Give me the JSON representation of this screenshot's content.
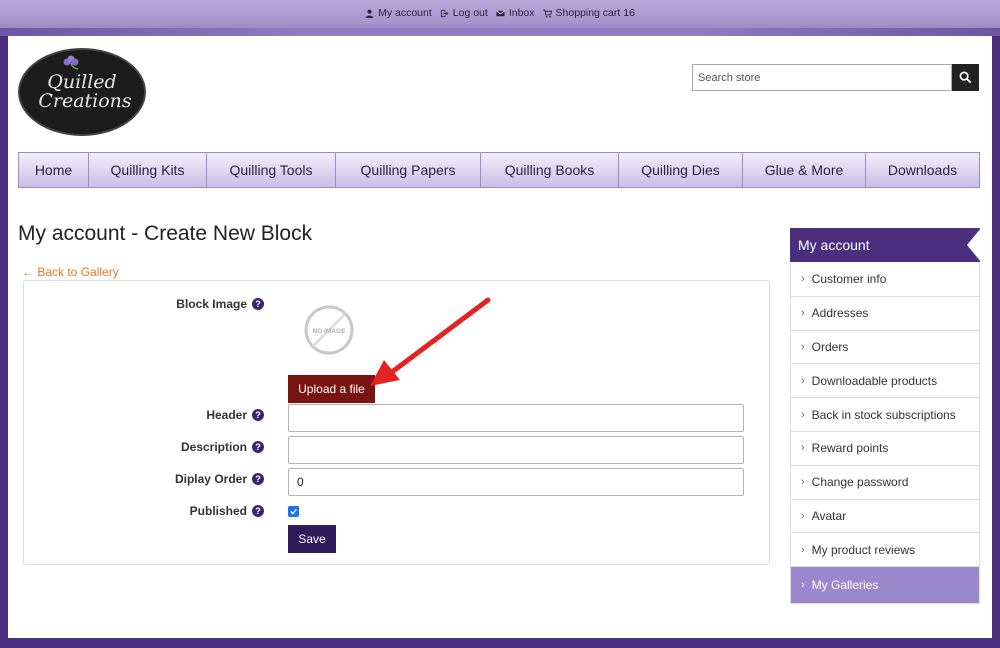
{
  "top_links": {
    "my_account": "My account",
    "log_out": "Log out",
    "inbox": "Inbox",
    "shopping_cart": "Shopping cart 16"
  },
  "logo": {
    "line1": "Quilled",
    "line2": "Creations"
  },
  "search": {
    "placeholder": "Search store"
  },
  "nav": [
    {
      "label": "Home"
    },
    {
      "label": "Quilling Kits"
    },
    {
      "label": "Quilling Tools"
    },
    {
      "label": "Quilling Papers"
    },
    {
      "label": "Quilling Books"
    },
    {
      "label": "Quilling Dies"
    },
    {
      "label": "Glue & More"
    },
    {
      "label": "Downloads"
    }
  ],
  "page_title": "My account - Create New Block",
  "back_link": "← Back to Gallery",
  "form": {
    "block_image_label": "Block Image",
    "no_image_text": "NO IMAGE",
    "upload_label": "Upload a file",
    "header_label": "Header",
    "header_value": "",
    "description_label": "Description",
    "description_value": "",
    "display_order_label": "Diplay Order",
    "display_order_value": "0",
    "published_label": "Published",
    "published_checked": true,
    "save_label": "Save"
  },
  "sidebar": {
    "title": "My account",
    "items": [
      {
        "label": "Customer info"
      },
      {
        "label": "Addresses"
      },
      {
        "label": "Orders"
      },
      {
        "label": "Downloadable products"
      },
      {
        "label": "Back in stock subscriptions"
      },
      {
        "label": "Reward points"
      },
      {
        "label": "Change password"
      },
      {
        "label": "Avatar"
      },
      {
        "label": "My product reviews"
      },
      {
        "label": "My Galleries",
        "active": true
      }
    ]
  },
  "colors": {
    "brand_purple": "#4b2f7e",
    "upload_red": "#7a1410",
    "link_orange": "#e87722",
    "active_item": "#9b87cc",
    "annotation_arrow": "#e32222"
  }
}
